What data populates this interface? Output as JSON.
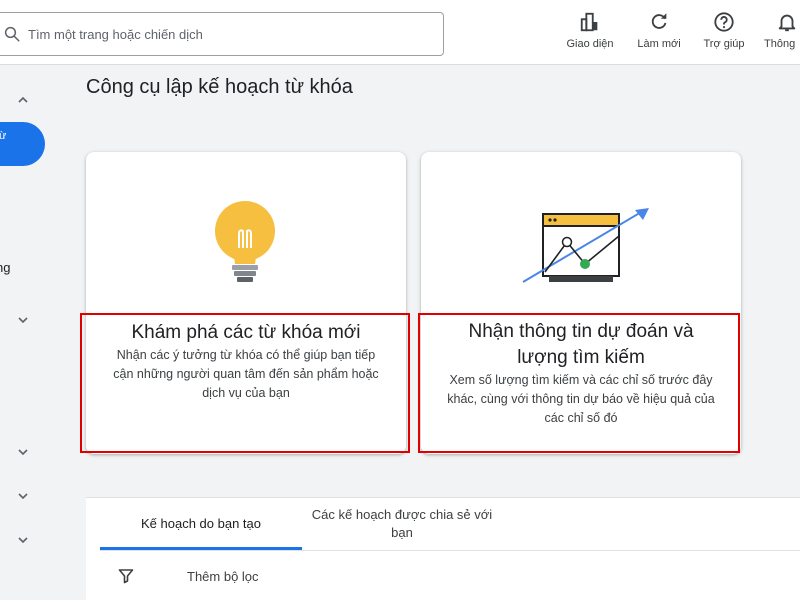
{
  "search": {
    "placeholder": "Tìm một trang hoặc chiến dịch"
  },
  "top_actions": [
    {
      "label": "Giao diện",
      "icon": "appearance-icon"
    },
    {
      "label": "Làm mới",
      "icon": "refresh-icon"
    },
    {
      "label": "Trợ giúp",
      "icon": "help-icon"
    },
    {
      "label": "Thông",
      "icon": "bell-icon"
    }
  ],
  "sidenav": {
    "active_label": "từ",
    "section_label": "ng"
  },
  "page_title": "Công cụ lập kế hoạch từ khóa",
  "cards": [
    {
      "title": "Khám phá các từ khóa mới",
      "description": "Nhận các ý tưởng từ khóa có thể giúp bạn tiếp cận những người quan tâm đến sản phẩm hoặc dịch vụ của bạn",
      "icon": "lightbulb-icon"
    },
    {
      "title": "Nhận thông tin dự đoán và lượng tìm kiếm",
      "description": "Xem số lượng tìm kiếm và các chỉ số trước đây khác, cùng với thông tin dự báo về hiệu quả của các chỉ số đó",
      "icon": "trend-chart-icon"
    }
  ],
  "plans": {
    "tabs": [
      {
        "label": "Kế hoạch do bạn tạo",
        "selected": true
      },
      {
        "label": "Các kế hoạch được chia sẻ với bạn",
        "selected": false
      }
    ],
    "filter_label": "Thêm bộ lọc"
  },
  "colors": {
    "accent": "#1a73e8",
    "highlight": "#e00000",
    "bulb": "#f6bf3f"
  }
}
